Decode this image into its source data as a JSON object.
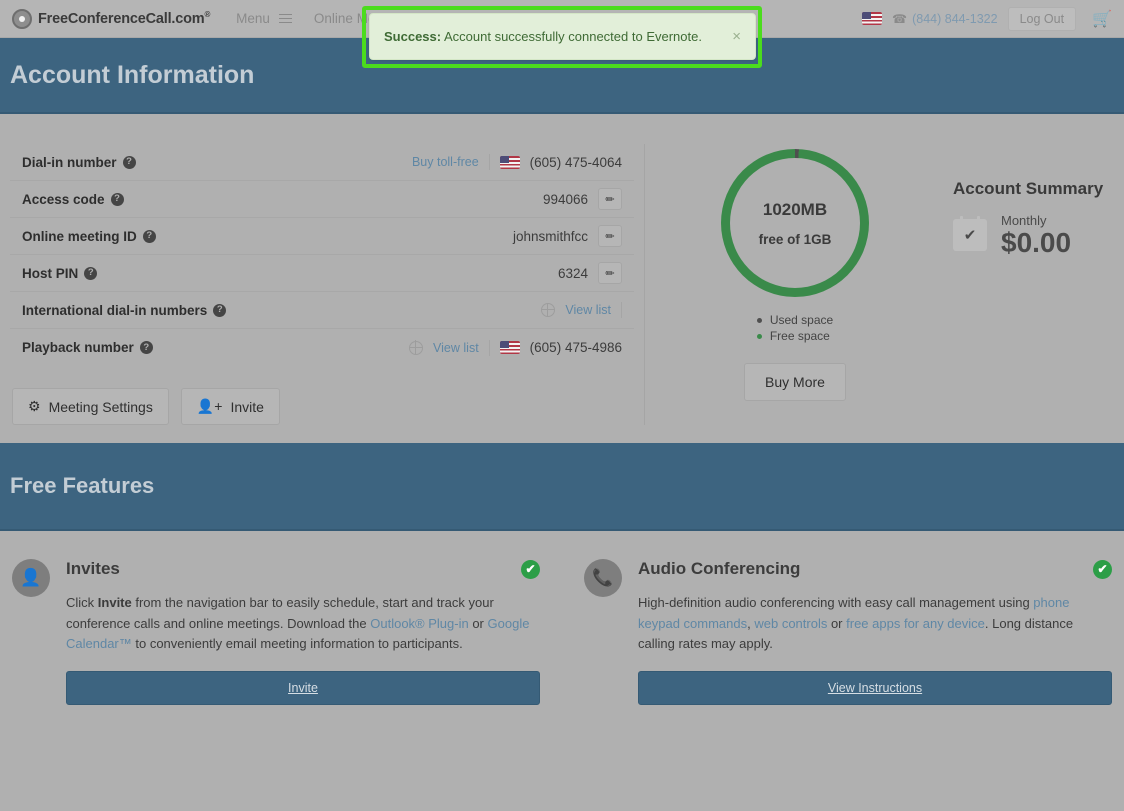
{
  "navbar": {
    "brand": "FreeConferenceCall.com",
    "brand_mark": "®",
    "menu_label": "Menu",
    "online_meeting_label": "Online Meeting",
    "phone": "(844) 844-1322",
    "logout_label": "Log Out",
    "flag_icon": "us-flag-icon",
    "phone_icon": "phone-icon",
    "cart_icon": "shopping-cart-icon",
    "hamburger_icon": "hamburger-menu-icon"
  },
  "alert": {
    "prefix": "Success:",
    "message": " Account successfully connected to Evernote.",
    "close_label": "×",
    "background": "#e2efd9",
    "text_color": "#3f6b35",
    "highlight_color": "#4bdc1d"
  },
  "page": {
    "title": "Account Information",
    "header_color": "#3d6480"
  },
  "account_info": {
    "rows": [
      {
        "label": "Dial-in number",
        "link": "Buy toll-free",
        "value": "(605) 475-4064",
        "has_flag": true,
        "has_edit": false,
        "has_globe": false
      },
      {
        "label": "Access code",
        "link": "",
        "value": "994066",
        "has_flag": false,
        "has_edit": true,
        "has_globe": false
      },
      {
        "label": "Online meeting ID",
        "link": "",
        "value": "johnsmithfcc",
        "has_flag": false,
        "has_edit": true,
        "has_globe": false
      },
      {
        "label": "Host PIN",
        "link": "",
        "value": "6324",
        "has_flag": false,
        "has_edit": true,
        "has_globe": false
      },
      {
        "label": "International dial-in numbers",
        "link": "View list",
        "value": "",
        "has_flag": false,
        "has_edit": false,
        "has_globe": true
      },
      {
        "label": "Playback number",
        "link": "View list",
        "value": "(605) 475-4986",
        "has_flag": true,
        "has_edit": false,
        "has_globe": true
      }
    ],
    "help_glyph": "?",
    "edit_glyph": "✏",
    "buttons": [
      {
        "label": "Meeting Settings",
        "icon": "gear-icon",
        "glyph": "✿"
      },
      {
        "label": "Invite",
        "icon": "add-user-icon",
        "glyph": "👤+"
      }
    ]
  },
  "storage": {
    "main_value": "1020MB",
    "sub_value": "free of 1GB",
    "legend": [
      {
        "label": "Used space",
        "color": "#4f4f4f"
      },
      {
        "label": "Free space",
        "color": "#3a8a4a"
      }
    ],
    "buy_more_label": "Buy More"
  },
  "summary": {
    "title": "Account Summary",
    "period": "Monthly",
    "amount": "$0.00",
    "icon": "calendar-check-icon",
    "check_glyph": "✔"
  },
  "features_section": {
    "title": "Free Features",
    "items": [
      {
        "title": "Invites",
        "icon": "add-user-icon",
        "icon_glyph": "👤",
        "status_glyph": "✔",
        "text_parts": [
          {
            "t": "Click ",
            "style": "plain"
          },
          {
            "t": "Invite",
            "style": "bold"
          },
          {
            "t": " from the navigation bar to easily schedule, start and track your conference calls and online meetings. Download the ",
            "style": "plain"
          },
          {
            "t": "Outlook® Plug-in",
            "style": "link"
          },
          {
            "t": " or ",
            "style": "plain"
          },
          {
            "t": "Google Calendar™",
            "style": "link"
          },
          {
            "t": " to conveniently email meeting information to participants.",
            "style": "plain"
          }
        ],
        "button_label": "Invite"
      },
      {
        "title": "Audio Conferencing",
        "icon": "phone-icon",
        "icon_glyph": "📞",
        "status_glyph": "✔",
        "text_parts": [
          {
            "t": "High-definition audio conferencing with easy call management using ",
            "style": "plain"
          },
          {
            "t": "phone keypad commands",
            "style": "link"
          },
          {
            "t": ", ",
            "style": "plain"
          },
          {
            "t": "web controls",
            "style": "link"
          },
          {
            "t": " or ",
            "style": "plain"
          },
          {
            "t": "free apps for any device",
            "style": "link"
          },
          {
            "t": ". Long distance calling rates may apply.",
            "style": "plain"
          }
        ],
        "button_label": "View Instructions"
      }
    ]
  }
}
